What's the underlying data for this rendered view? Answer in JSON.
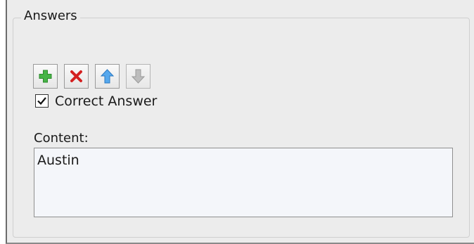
{
  "answers_group": {
    "legend": "Answers",
    "toolbar": {
      "buttons": [
        {
          "id": "add",
          "icon": "plus-icon",
          "color": "#3aa63a",
          "enabled": true
        },
        {
          "id": "delete",
          "icon": "close-icon",
          "color": "#d42020",
          "enabled": true
        },
        {
          "id": "move-up",
          "icon": "arrow-up-icon",
          "color": "#3b8ed8",
          "enabled": true
        },
        {
          "id": "move-down",
          "icon": "arrow-down-icon",
          "color": "#a8a8a8",
          "enabled": false
        }
      ]
    },
    "correct_answer": {
      "label": "Correct Answer",
      "checked": true
    },
    "content": {
      "label": "Content:",
      "value": "Austin"
    }
  }
}
